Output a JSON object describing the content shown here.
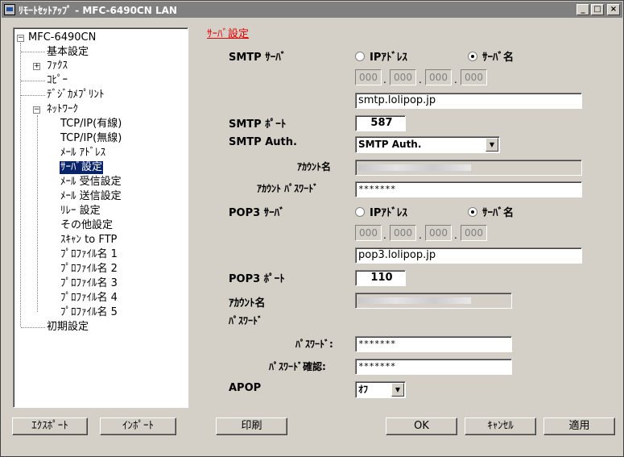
{
  "window": {
    "title": "ﾘﾓｰﾄｾｯﾄｱｯﾌﾟ - MFC-6490CN LAN",
    "minimize": "_",
    "maximize": "□",
    "close": "×"
  },
  "tree": {
    "root": "MFC-6490CN",
    "items": [
      "基本設定",
      "ﾌｧｸｽ",
      "ｺﾋﾟｰ",
      "ﾃﾞｼﾞｶﾒﾌﾟﾘﾝﾄ",
      "ﾈｯﾄﾜｰｸ",
      "TCP/IP(有線)",
      "TCP/IP(無線)",
      "ﾒｰﾙ ｱﾄﾞﾚｽ",
      "ｻｰﾊﾞ設定",
      "ﾒｰﾙ 受信設定",
      "ﾒｰﾙ 送信設定",
      "ﾘﾚｰ 設定",
      "その他設定",
      "ｽｷｬﾝ to FTP",
      "ﾌﾟﾛﾌｧｲﾙ名 1",
      "ﾌﾟﾛﾌｧｲﾙ名 2",
      "ﾌﾟﾛﾌｧｲﾙ名 3",
      "ﾌﾟﾛﾌｧｲﾙ名 4",
      "ﾌﾟﾛﾌｧｲﾙ名 5",
      "初期設定"
    ],
    "plus": "+",
    "minus": "−"
  },
  "section_title": "ｻｰﾊﾞ設定",
  "smtp": {
    "server_label": "SMTP ｻｰﾊﾞ",
    "radio_ip": "IPｱﾄﾞﾚｽ",
    "radio_name": "ｻｰﾊﾞ名",
    "ip": [
      "000",
      "000",
      "000",
      "000"
    ],
    "server_name": "smtp.lolipop.jp",
    "port_label": "SMTP ﾎﾟｰﾄ",
    "port": "587",
    "auth_label": "SMTP Auth.",
    "auth_value": "SMTP Auth.",
    "account_label": "ｱｶｳﾝﾄ名",
    "password_label": "ｱｶｳﾝﾄ ﾊﾟｽﾜｰﾄﾞ",
    "password": "*******"
  },
  "pop3": {
    "server_label": "POP3 ｻｰﾊﾞ",
    "radio_ip": "IPｱﾄﾞﾚｽ",
    "radio_name": "ｻｰﾊﾞ名",
    "ip": [
      "000",
      "000",
      "000",
      "000"
    ],
    "server_name": "pop3.lolipop.jp",
    "port_label": "POP3 ﾎﾟｰﾄ",
    "port": "110",
    "account_label": "ｱｶｳﾝﾄ名",
    "password_heading": "ﾊﾟｽﾜｰﾄﾞ",
    "password_label": "ﾊﾟｽﾜｰﾄﾞ:",
    "password": "*******",
    "confirm_label": "ﾊﾟｽﾜｰﾄﾞ確認:",
    "confirm": "*******",
    "apop_label": "APOP",
    "apop_value": "ｵﾌ"
  },
  "dropdown_arrow": "▼",
  "buttons": {
    "export": "ｴｸｽﾎﾟｰﾄ",
    "import": "ｲﾝﾎﾟｰﾄ",
    "print": "印刷",
    "ok": "OK",
    "cancel": "ｷｬﾝｾﾙ",
    "apply": "適用"
  }
}
